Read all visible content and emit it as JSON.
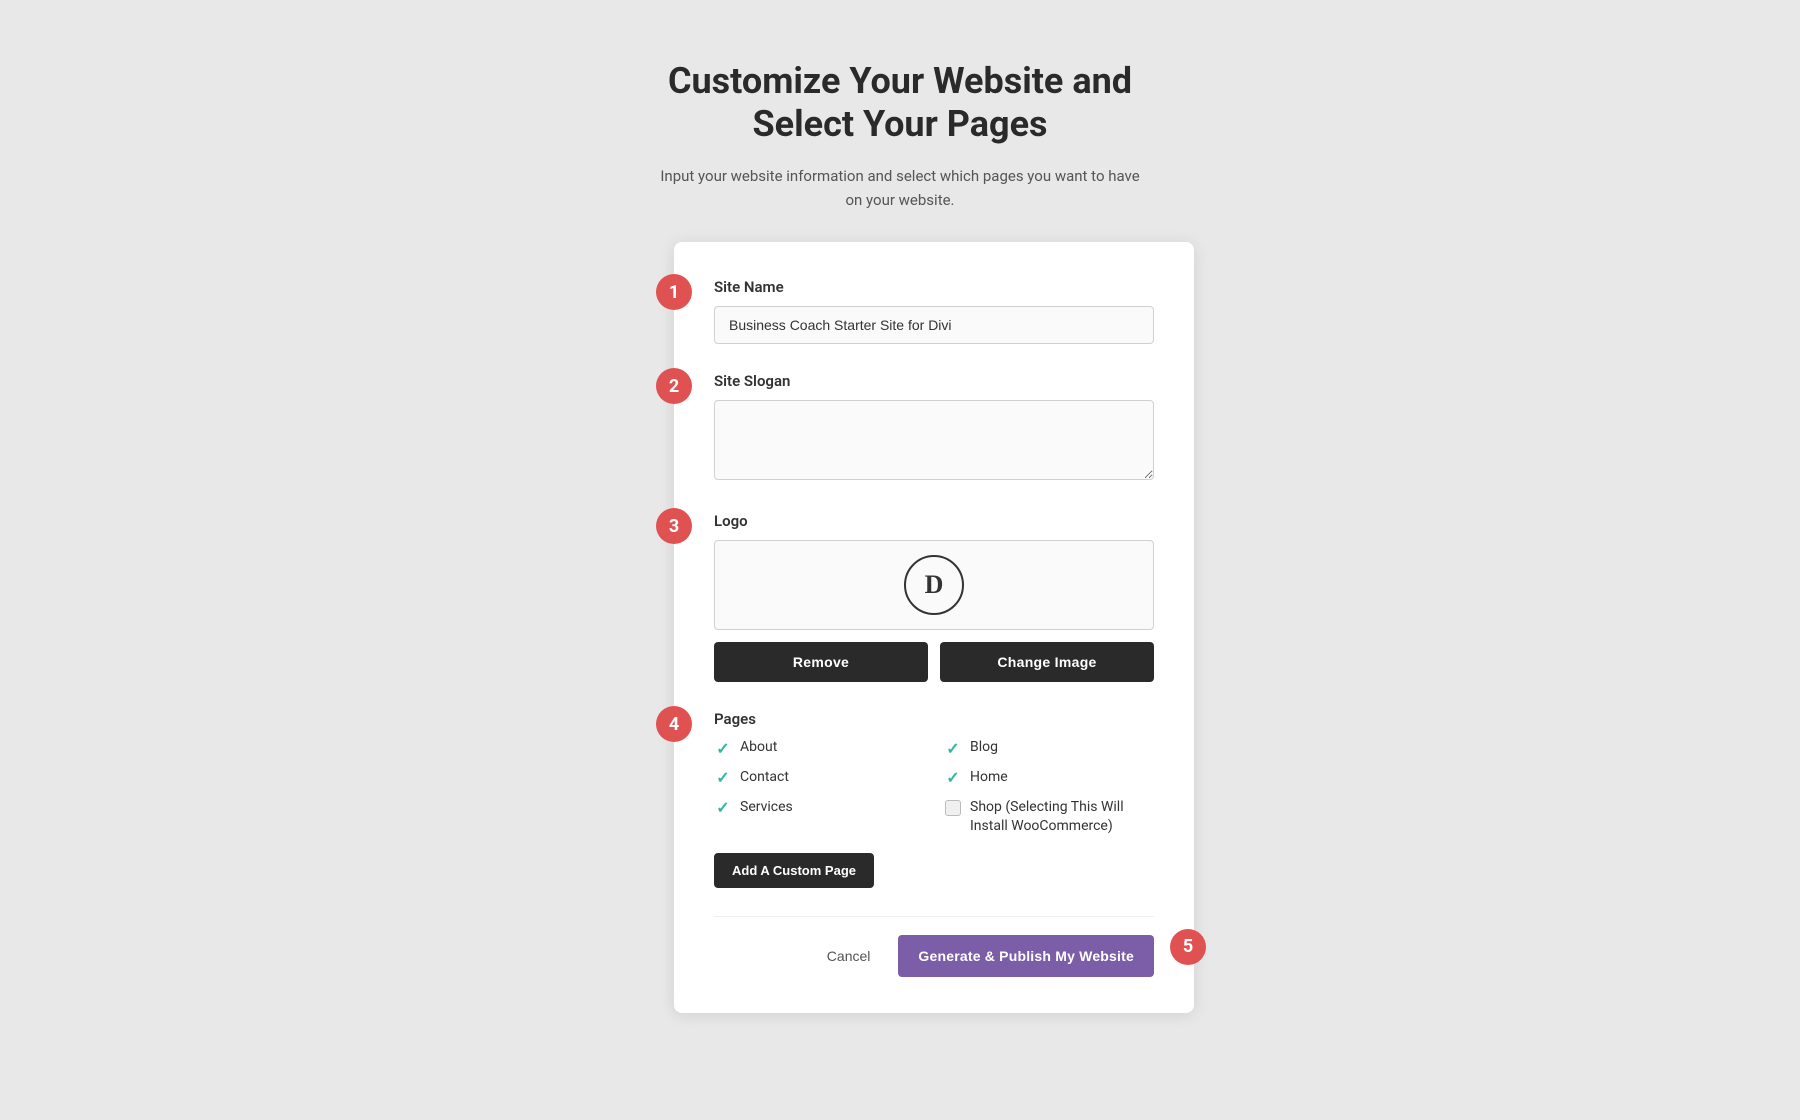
{
  "header": {
    "title_line1": "Customize Your Website and",
    "title_line2": "Select Your Pages",
    "subtitle": "Input your website information and select which pages you want to have on your website."
  },
  "steps": [
    {
      "number": "1",
      "label": "Site Name",
      "input_value": "Business Coach Starter Site for Divi",
      "input_placeholder": "Business Coach Starter Site for Divi",
      "type": "text"
    },
    {
      "number": "2",
      "label": "Site Slogan",
      "input_value": "",
      "input_placeholder": "",
      "type": "textarea"
    },
    {
      "number": "3",
      "label": "Logo",
      "logo_letter": "D",
      "remove_label": "Remove",
      "change_label": "Change Image"
    },
    {
      "number": "4",
      "label": "Pages",
      "pages": [
        {
          "name": "About",
          "checked": true,
          "col": 0
        },
        {
          "name": "Blog",
          "checked": true,
          "col": 1
        },
        {
          "name": "Contact",
          "checked": true,
          "col": 0
        },
        {
          "name": "Home",
          "checked": true,
          "col": 1
        },
        {
          "name": "Services",
          "checked": true,
          "col": 0
        },
        {
          "name": "Shop (Selecting This Will Install WooCommerce)",
          "checked": false,
          "col": 1
        }
      ],
      "add_custom_label": "Add A Custom Page"
    }
  ],
  "actions": {
    "cancel_label": "Cancel",
    "publish_label": "Generate & Publish My Website",
    "step5_number": "5"
  }
}
